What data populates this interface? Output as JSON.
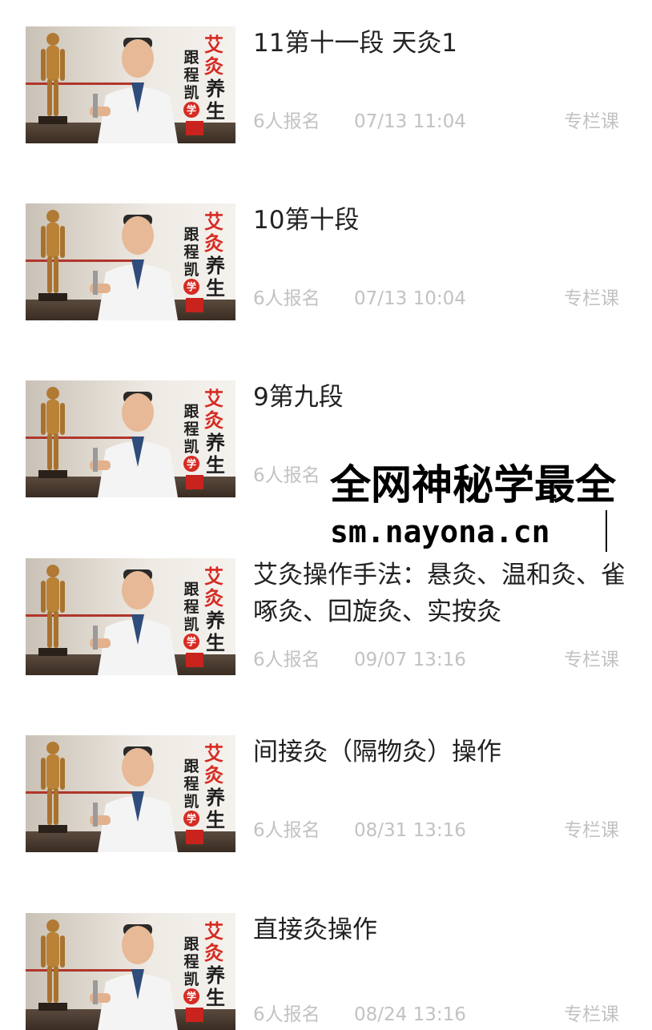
{
  "thumbnail": {
    "brand_black": "跟程凯",
    "brand_red": "艾灸",
    "brand_dark": "养生",
    "brand_badge": "学"
  },
  "items": [
    {
      "title": "11第十一段 天灸1",
      "enrolled": "6人报名",
      "time": "07/13 11:04",
      "type": "专栏课"
    },
    {
      "title": "10第十段",
      "enrolled": "6人报名",
      "time": "07/13 10:04",
      "type": "专栏课"
    },
    {
      "title": "9第九段",
      "enrolled": "6人报名",
      "time": "",
      "type": ""
    },
    {
      "title": "艾灸操作手法：悬灸、温和灸、雀啄灸、回旋灸、实按灸",
      "enrolled": "6人报名",
      "time": "09/07 13:16",
      "type": "专栏课"
    },
    {
      "title": "间接灸（隔物灸）操作",
      "enrolled": "6人报名",
      "time": "08/31 13:16",
      "type": "专栏课"
    },
    {
      "title": "直接灸操作",
      "enrolled": "6人报名",
      "time": "08/24 13:16",
      "type": "专栏课"
    }
  ],
  "watermark": {
    "line1": "全网神秘学最全",
    "line2": "sm.nayona.cn"
  }
}
